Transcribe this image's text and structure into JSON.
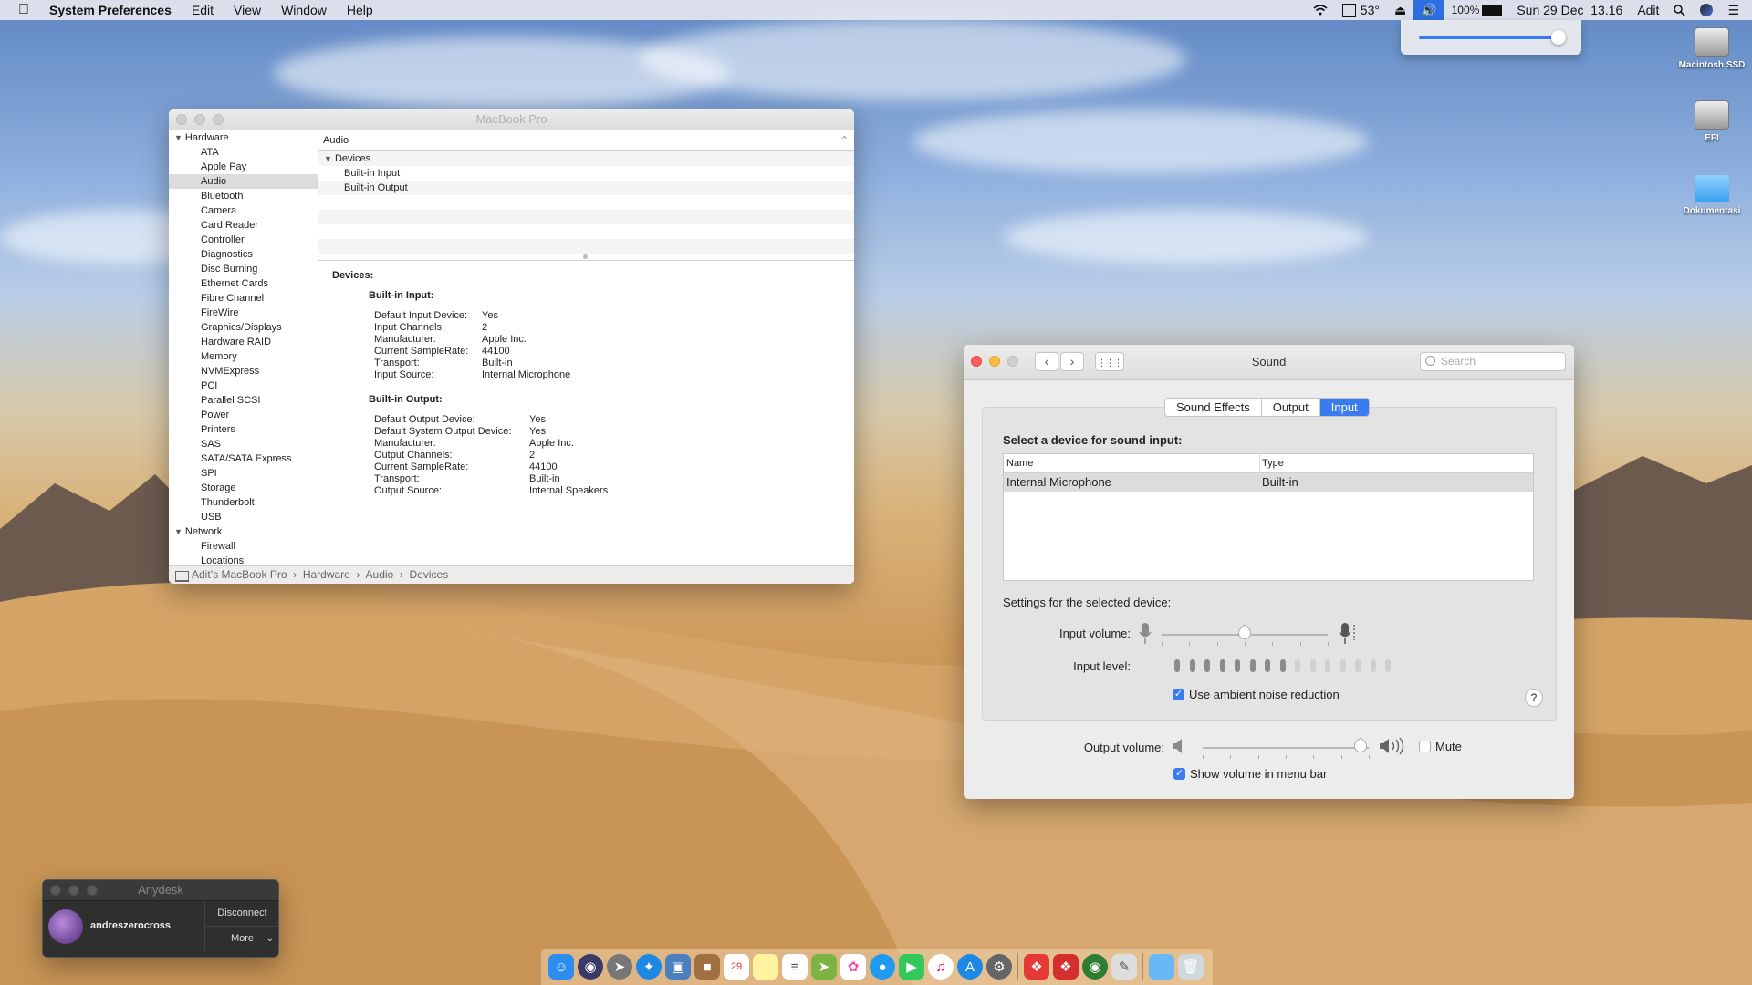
{
  "menubar": {
    "app": "System Preferences",
    "items": [
      "Edit",
      "View",
      "Window",
      "Help"
    ],
    "temperature": "53°",
    "battery": "100%",
    "datetime": "Sun 29 Dec  13.16",
    "user": "Adit"
  },
  "desktop_icons": [
    {
      "label": "Macintosh SSD"
    },
    {
      "label": "EFI"
    },
    {
      "label": "Dokumentasi"
    }
  ],
  "sysinfo": {
    "title": "MacBook Pro",
    "sidebar": {
      "hardware_label": "Hardware",
      "hardware_items": [
        "ATA",
        "Apple Pay",
        "Audio",
        "Bluetooth",
        "Camera",
        "Card Reader",
        "Controller",
        "Diagnostics",
        "Disc Burning",
        "Ethernet Cards",
        "Fibre Channel",
        "FireWire",
        "Graphics/Displays",
        "Hardware RAID",
        "Memory",
        "NVMExpress",
        "PCI",
        "Parallel SCSI",
        "Power",
        "Printers",
        "SAS",
        "SATA/SATA Express",
        "SPI",
        "Storage",
        "Thunderbolt",
        "USB"
      ],
      "network_label": "Network",
      "network_items": [
        "Firewall",
        "Locations"
      ],
      "selected": "Audio"
    },
    "list_header": "Audio",
    "tree": {
      "group": "Devices",
      "items": [
        "Built-in Input",
        "Built-in Output"
      ]
    },
    "detail": {
      "heading": "Devices:",
      "input_title": "Built-in Input:",
      "input": [
        {
          "k": "Default Input Device:",
          "v": "Yes"
        },
        {
          "k": "Input Channels:",
          "v": "2"
        },
        {
          "k": "Manufacturer:",
          "v": "Apple Inc."
        },
        {
          "k": "Current SampleRate:",
          "v": "44100"
        },
        {
          "k": "Transport:",
          "v": "Built-in"
        },
        {
          "k": "Input Source:",
          "v": "Internal Microphone"
        }
      ],
      "output_title": "Built-in Output:",
      "output": [
        {
          "k": "Default Output Device:",
          "v": "Yes"
        },
        {
          "k": "Default System Output Device:",
          "v": "Yes"
        },
        {
          "k": "Manufacturer:",
          "v": "Apple Inc."
        },
        {
          "k": "Output Channels:",
          "v": "2"
        },
        {
          "k": "Current SampleRate:",
          "v": "44100"
        },
        {
          "k": "Transport:",
          "v": "Built-in"
        },
        {
          "k": "Output Source:",
          "v": "Internal Speakers"
        }
      ]
    },
    "breadcrumb": "Adit’s MacBook Pro  ›  Hardware  ›  Audio  ›  Devices"
  },
  "sound": {
    "title": "Sound",
    "search_placeholder": "Search",
    "tabs": [
      "Sound Effects",
      "Output",
      "Input"
    ],
    "active_tab": "Input",
    "select_label": "Select a device for sound input:",
    "col_name": "Name",
    "col_type": "Type",
    "device_name": "Internal Microphone",
    "device_type": "Built-in",
    "settings_label": "Settings for the selected device:",
    "input_volume_label": "Input volume:",
    "input_level_label": "Input level:",
    "noise_reduction_label": "Use ambient noise reduction",
    "output_volume_label": "Output volume:",
    "mute_label": "Mute",
    "show_volume_label": "Show volume in menu bar",
    "help": "?",
    "input_volume": 0.5,
    "input_level_active": 8,
    "input_level_total": 15,
    "output_volume": 0.95,
    "noise_reduction_checked": true,
    "mute_checked": false,
    "show_volume_checked": true,
    "accent": "#3a7bf0"
  },
  "anydesk": {
    "title": "Anydesk",
    "user": "andreszerocross",
    "disconnect": "Disconnect",
    "more": "More"
  }
}
